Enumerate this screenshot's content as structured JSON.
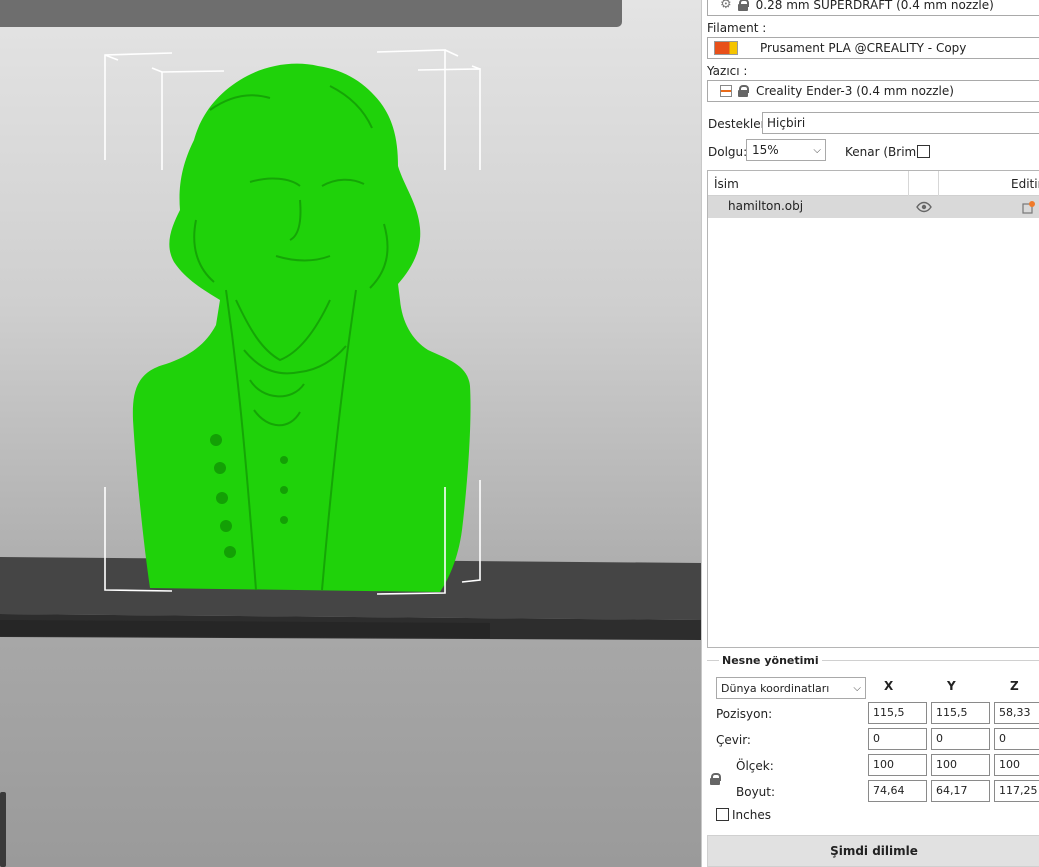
{
  "panel": {
    "profile_text": "0.28 mm SUPERDRAFT (0.4 mm nozzle)",
    "filament_label": "Filament :",
    "filament_value": "Prusament PLA @CREALITY - Copy",
    "printer_label": "Yazıcı :",
    "printer_value": "Creality Ender-3 (0.4 mm nozzle)",
    "supports_label": "Destekler:",
    "supports_value": "Hiçbiri",
    "infill_label": "Dolgu:",
    "infill_value": "15%",
    "brim_label": "Kenar (Brim):",
    "brim_checked": false
  },
  "objects": {
    "col_name": "İsim",
    "col_edit": "Editin",
    "rows": [
      {
        "name": "hamilton.obj"
      }
    ]
  },
  "manipulation": {
    "title": "Nesne yönetimi",
    "coord_system": "Dünya koordinatları",
    "axes": [
      "X",
      "Y",
      "Z"
    ],
    "position_label": "Pozisyon:",
    "rotate_label": "Çevir:",
    "scale_label": "Ölçek:",
    "size_label": "Boyut:",
    "position": [
      "115,5",
      "115,5",
      "58,33"
    ],
    "rotation": [
      "0",
      "0",
      "0"
    ],
    "scale": [
      "100",
      "100",
      "100"
    ],
    "size": [
      "74,64",
      "64,17",
      "117,25"
    ],
    "inches_label": "Inches",
    "inches_checked": false
  },
  "actions": {
    "slice_label": "Şimdi dilimle"
  },
  "viewport": {
    "model_color": "#1fd20a",
    "bed_color": "#3a3a3a",
    "toolbar_icons": [
      "delete-icon",
      "paste-icon",
      "arrange-icon",
      "add-instance-icon",
      "remove-instance-icon",
      "split-objects-icon",
      "split-parts-icon",
      "layers-editing-icon",
      "search-icon",
      "menu-icon",
      "undo-icon",
      "redo-icon"
    ]
  }
}
